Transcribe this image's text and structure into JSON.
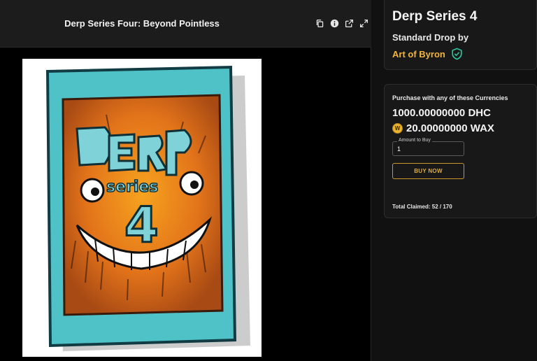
{
  "media": {
    "title": "Derp Series Four: Beyond Pointless",
    "toolbar": {
      "copy_icon": "copy-icon",
      "info_icon": "info-icon",
      "open_external_icon": "open-external-icon",
      "fullscreen_icon": "fullscreen-icon"
    }
  },
  "drop": {
    "title": "Derp Series 4",
    "type_prefix": "Standard Drop by",
    "creator": "Art of Byron",
    "verified_icon": "verified-shield-icon"
  },
  "purchase": {
    "label": "Purchase with any of these Currencies",
    "price_dhc": "1000.00000000 DHC",
    "price_wax": "20.00000000 WAX",
    "wax_icon": "wax-coin-icon",
    "amount_label": "Amount to Buy",
    "amount_value": "1",
    "buy_label": "BUY NOW",
    "total_claimed": "Total Claimed: 52 / 170"
  },
  "colors": {
    "background": "#111111",
    "card": "#181818",
    "accent_gold": "#f3b63b",
    "verified_teal": "#2ec4a0"
  }
}
